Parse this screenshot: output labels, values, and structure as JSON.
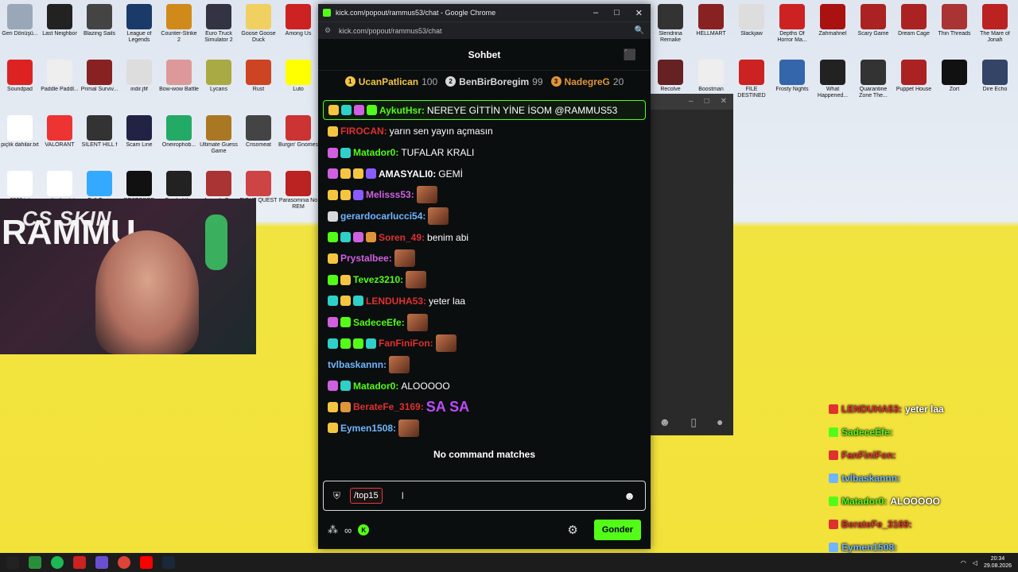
{
  "window": {
    "title": "kick.com/popout/rammus53/chat - Google Chrome",
    "url": "kick.com/popout/rammus53/chat",
    "min_symbol": "–",
    "max_symbol": "□",
    "close_symbol": "✕"
  },
  "chat": {
    "header_title": "Sohbet",
    "leaderboard": [
      {
        "rank": "1",
        "name": "UcanPatlican",
        "score": "100",
        "color": "#f5c542"
      },
      {
        "rank": "2",
        "name": "BenBirBoregim",
        "score": "99",
        "color": "#d9d9d9"
      },
      {
        "rank": "3",
        "name": "NadegreG",
        "score": "20",
        "color": "#e0953a"
      }
    ],
    "messages": [
      {
        "badges": [
          "#f5c542",
          "#2fd0c8",
          "#d060e0",
          "#53fc18"
        ],
        "user": "AykutHsr:",
        "color": "#53fc18",
        "text": " NEREYE GİTTİN YİNE İSOM @RAMMUS53",
        "pinned": true
      },
      {
        "badges": [
          "#f5c542"
        ],
        "user": "FIROCAN:",
        "color": "#e03030",
        "text": " yarın sen yayın açmasın"
      },
      {
        "badges": [
          "#d060e0",
          "#2fd0c8"
        ],
        "user": "Matador0:",
        "color": "#53fc18",
        "text": " TUFALAR KRALI"
      },
      {
        "badges": [
          "#d060e0",
          "#f5c542",
          "#f5c542",
          "#8a5cff"
        ],
        "user": "AMASYALI0:",
        "color": "#ffffff",
        "text": " GEMİ"
      },
      {
        "badges": [
          "#f5c542",
          "#f5c542",
          "#8a5cff"
        ],
        "user": "Melisss53:",
        "color": "#d060e0",
        "text": "",
        "emote": true
      },
      {
        "badges": [
          "#d9d9d9"
        ],
        "user": "gerardocarlucci54:",
        "color": "#6fb6ff",
        "text": "",
        "emote": true
      },
      {
        "badges": [
          "#53fc18",
          "#2fd0c8",
          "#d060e0",
          "#e0953a"
        ],
        "user": "Soren_49:",
        "color": "#e03030",
        "text": " benim abi"
      },
      {
        "badges": [
          "#f5c542"
        ],
        "user": "Prystalbee:",
        "color": "#d060e0",
        "text": "",
        "emote": true
      },
      {
        "badges": [
          "#53fc18",
          "#f5c542"
        ],
        "user": "Tevez3210:",
        "color": "#53fc18",
        "text": "",
        "emote": true
      },
      {
        "badges": [
          "#2fd0c8",
          "#f5c542",
          "#2fd0c8"
        ],
        "user": "LENDUHA53:",
        "color": "#e03030",
        "text": " yeter laa"
      },
      {
        "badges": [
          "#d060e0",
          "#53fc18"
        ],
        "user": "SadeceEfe:",
        "color": "#53fc18",
        "text": "",
        "emote": true
      },
      {
        "badges": [
          "#2fd0c8",
          "#53fc18",
          "#53fc18",
          "#2fd0c8"
        ],
        "user": "FanFiniFon:",
        "color": "#e03030",
        "text": "",
        "emote": true
      },
      {
        "badges": [],
        "user": "tvlbaskannn:",
        "color": "#6fb6ff",
        "text": "",
        "emote": true
      },
      {
        "badges": [
          "#d060e0",
          "#2fd0c8"
        ],
        "user": "Matador0:",
        "color": "#53fc18",
        "text": " ALOOOOO"
      },
      {
        "badges": [
          "#f5c542",
          "#e0953a"
        ],
        "user": "BerateFe_3169:",
        "color": "#e03030",
        "text": "",
        "big_emote": "SA SA"
      },
      {
        "badges": [
          "#f5c542"
        ],
        "user": "Eymen1508:",
        "color": "#6fb6ff",
        "text": "",
        "emote": true
      }
    ],
    "no_command": "No command matches",
    "input_value": "/top15",
    "send_label": "Gonder"
  },
  "webcam": {
    "logo_text": "CS SKIN",
    "name_text": "RAMMU"
  },
  "overlay": [
    {
      "user": "LENDUHA53:",
      "text": " yeter laa",
      "color": "#e03030"
    },
    {
      "user": "SadeceEfe:",
      "text": "",
      "color": "#53fc18"
    },
    {
      "user": "FanFiniFon:",
      "text": "",
      "color": "#e03030"
    },
    {
      "user": "tvlbaskannn:",
      "text": "",
      "color": "#6fb6ff"
    },
    {
      "user": "Matador0:",
      "text": " ALOOOOO",
      "color": "#53fc18"
    },
    {
      "user": "BerateFe_3169:",
      "text": "",
      "color": "#e03030"
    },
    {
      "user": "Eymen1508:",
      "text": "",
      "color": "#6fb6ff"
    }
  ],
  "desktop_left": [
    {
      "label": "Geri Dönüşü...",
      "color": "#9aa7b8"
    },
    {
      "label": "Last Neighbor",
      "color": "#222"
    },
    {
      "label": "Blazing Sails",
      "color": "#444"
    },
    {
      "label": "League of Legends",
      "color": "#1a3a6a"
    },
    {
      "label": "Counter-Strike 2",
      "color": "#d08a1a"
    },
    {
      "label": "Euro Truck Simulator 2",
      "color": "#334"
    },
    {
      "label": "Goose Goose Duck",
      "color": "#f0d060"
    },
    {
      "label": "Among Us",
      "color": "#c22"
    },
    {
      "label": "Soundpad",
      "color": "#d22"
    },
    {
      "label": "Paddle Paddl...",
      "color": "#eee"
    },
    {
      "label": "Primal Surviv...",
      "color": "#822"
    },
    {
      "label": "indir.jfif",
      "color": "#ddd"
    },
    {
      "label": "Bow-wow Battle",
      "color": "#d99"
    },
    {
      "label": "Lycans",
      "color": "#aa4"
    },
    {
      "label": "Rust",
      "color": "#c42"
    },
    {
      "label": "Luto",
      "color": "#ff0"
    },
    {
      "label": "piçlik dahilar.txt",
      "color": "#fff"
    },
    {
      "label": "VALORANT",
      "color": "#e33"
    },
    {
      "label": "SILENT HILL f",
      "color": "#333"
    },
    {
      "label": "Scam Line",
      "color": "#224"
    },
    {
      "label": "Oneirophob...",
      "color": "#2a6"
    },
    {
      "label": "Ultimate Guess Game",
      "color": "#a72"
    },
    {
      "label": "Crisomeat",
      "color": "#444"
    },
    {
      "label": "Burgin' Gnomes",
      "color": "#c33"
    },
    {
      "label": "2222.txt",
      "color": "#fff"
    },
    {
      "label": "anilardan.txt",
      "color": "#fff"
    },
    {
      "label": "Fall Guys",
      "color": "#3af"
    },
    {
      "label": "RESTORER",
      "color": "#111"
    },
    {
      "label": "Devil of the",
      "color": "#222"
    },
    {
      "label": "Animaly Bar",
      "color": "#a33"
    },
    {
      "label": "FIGHT QUEST",
      "color": "#c44"
    },
    {
      "label": "Parasomnia No REM",
      "color": "#b22"
    }
  ],
  "desktop_right": [
    {
      "label": "Slendrina Remake",
      "color": "#333"
    },
    {
      "label": "HELLMART",
      "color": "#822"
    },
    {
      "label": "Slackjaw",
      "color": "#ddd"
    },
    {
      "label": "Depths Of Horror Ma...",
      "color": "#c22"
    },
    {
      "label": "Zahmahnel",
      "color": "#a11"
    },
    {
      "label": "Scary Game",
      "color": "#a22"
    },
    {
      "label": "Dream Cage",
      "color": "#a22"
    },
    {
      "label": "Thin Threads",
      "color": "#a33"
    },
    {
      "label": "The Mare of Jonah",
      "color": "#b22"
    },
    {
      "label": "Recolve",
      "color": "#622"
    },
    {
      "label": "Boostman",
      "color": "#eee"
    },
    {
      "label": "FILE DESTINED",
      "color": "#c22"
    },
    {
      "label": "Frosty Nights",
      "color": "#36a"
    },
    {
      "label": "What Happened...",
      "color": "#222"
    },
    {
      "label": "Quarantine Zone The...",
      "color": "#333"
    },
    {
      "label": "Puppet House",
      "color": "#a22"
    },
    {
      "label": "Zort",
      "color": "#111"
    },
    {
      "label": "Dire Echo",
      "color": "#346"
    }
  ],
  "taskbar": {
    "time": "20:34",
    "date": "29.08.2026"
  }
}
